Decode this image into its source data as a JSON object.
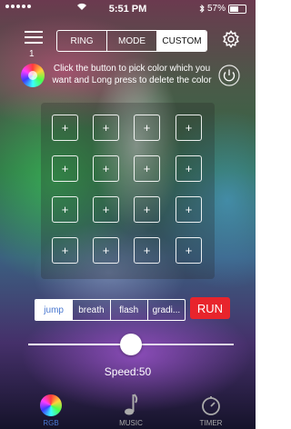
{
  "status_bar": {
    "time": "5:51 PM",
    "battery": "57%",
    "battery_level": 0.57
  },
  "menu": {
    "count": "1"
  },
  "top_segment": [
    {
      "label": "RING",
      "active": false
    },
    {
      "label": "MODE",
      "active": false
    },
    {
      "label": "CUSTOM",
      "active": true
    }
  ],
  "instruction": "Click the button to pick color which you want and Long press to delete the color",
  "color_slots": [
    "+",
    "+",
    "+",
    "+",
    "+",
    "+",
    "+",
    "+",
    "+",
    "+",
    "+",
    "+",
    "+",
    "+",
    "+",
    "+"
  ],
  "effect_modes": [
    {
      "label": "jump",
      "active": true
    },
    {
      "label": "breath",
      "active": false
    },
    {
      "label": "flash",
      "active": false
    },
    {
      "label": "gradi...",
      "active": false
    }
  ],
  "run_label": "RUN",
  "speed": {
    "label": "Speed:50",
    "value": 50,
    "max": 100
  },
  "tabs": [
    {
      "label": "RGB",
      "icon": "color-wheel-icon",
      "active": true
    },
    {
      "label": "MUSIC",
      "icon": "music-note-icon",
      "active": false
    },
    {
      "label": "TIMER",
      "icon": "timer-icon",
      "active": false
    }
  ],
  "colors": {
    "accent": "#4a78d0",
    "run": "#e8242c"
  }
}
